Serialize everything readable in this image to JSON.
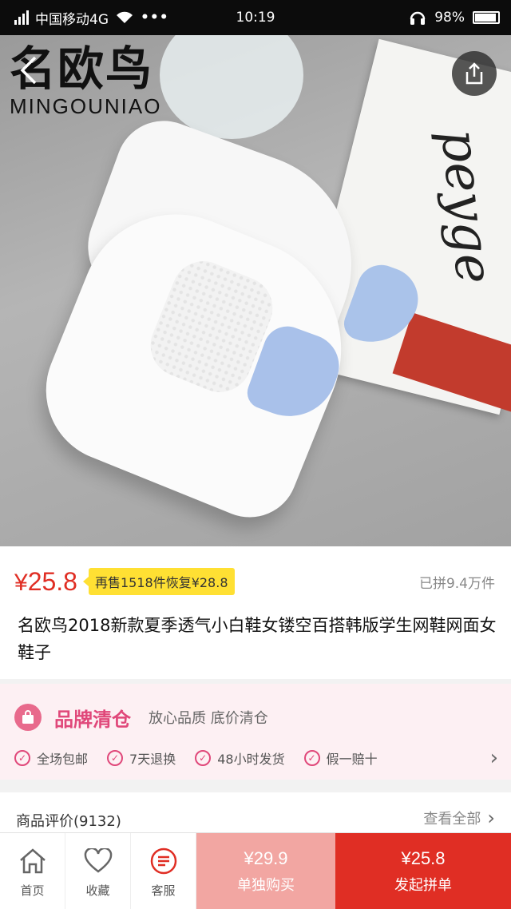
{
  "status_bar": {
    "carrier": "中国移动4G",
    "time": "10:19",
    "battery": "98%",
    "more": "•••"
  },
  "hero": {
    "brand_cn": "名欧鸟",
    "brand_en": "MINGOUNIAO",
    "book_text": "peyge"
  },
  "product": {
    "currency": "¥",
    "price": "25.8",
    "promo_tag": "再售1518件恢复¥28.8",
    "sold": "已拼9.4万件",
    "title": "名欧鸟2018新款夏季透气小白鞋女镂空百搭韩版学生网鞋网面女鞋子"
  },
  "clearance": {
    "title": "品牌清仓",
    "subtitle": "放心品质 底价清仓",
    "items": [
      "全场包邮",
      "7天退换",
      "48小时发货",
      "假一赔十"
    ]
  },
  "reviews": {
    "title": "商品评价(9132)",
    "view_all": "查看全部"
  },
  "bottom_nav": {
    "home": "首页",
    "favorite": "收藏",
    "service": "客服",
    "buy_alone_price": "¥29.9",
    "buy_alone_label": "单独购买",
    "buy_group_price": "¥25.8",
    "buy_group_label": "发起拼单"
  },
  "colors": {
    "accent_red": "#e02e24",
    "pink": "#e0487a",
    "promo_yellow": "#ffe033",
    "buy_alone_bg": "#f2a6a2"
  }
}
